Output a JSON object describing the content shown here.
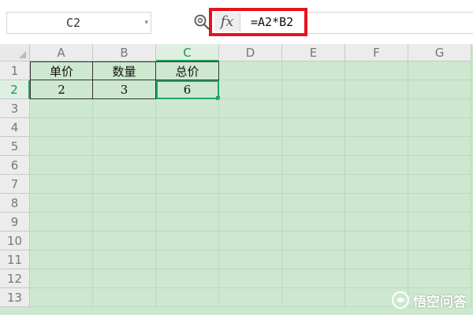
{
  "formula_bar": {
    "name_box": "C2",
    "name_box_arrow": "▾",
    "fx": "fx",
    "formula": "=A2*B2"
  },
  "columns": [
    "A",
    "B",
    "C",
    "D",
    "E",
    "F",
    "G"
  ],
  "rows": [
    "1",
    "2",
    "3",
    "4",
    "5",
    "6",
    "7",
    "8",
    "9",
    "10",
    "11",
    "12",
    "13"
  ],
  "active_cell": "C2",
  "table": {
    "headers": [
      "单价",
      "数量",
      "总价"
    ],
    "values": [
      "2",
      "3",
      "6"
    ]
  },
  "watermark": {
    "text": "悟空问答"
  },
  "colors": {
    "grid_background": "#cde8cf",
    "selection": "#21a366",
    "highlight_box": "#e8121c"
  }
}
